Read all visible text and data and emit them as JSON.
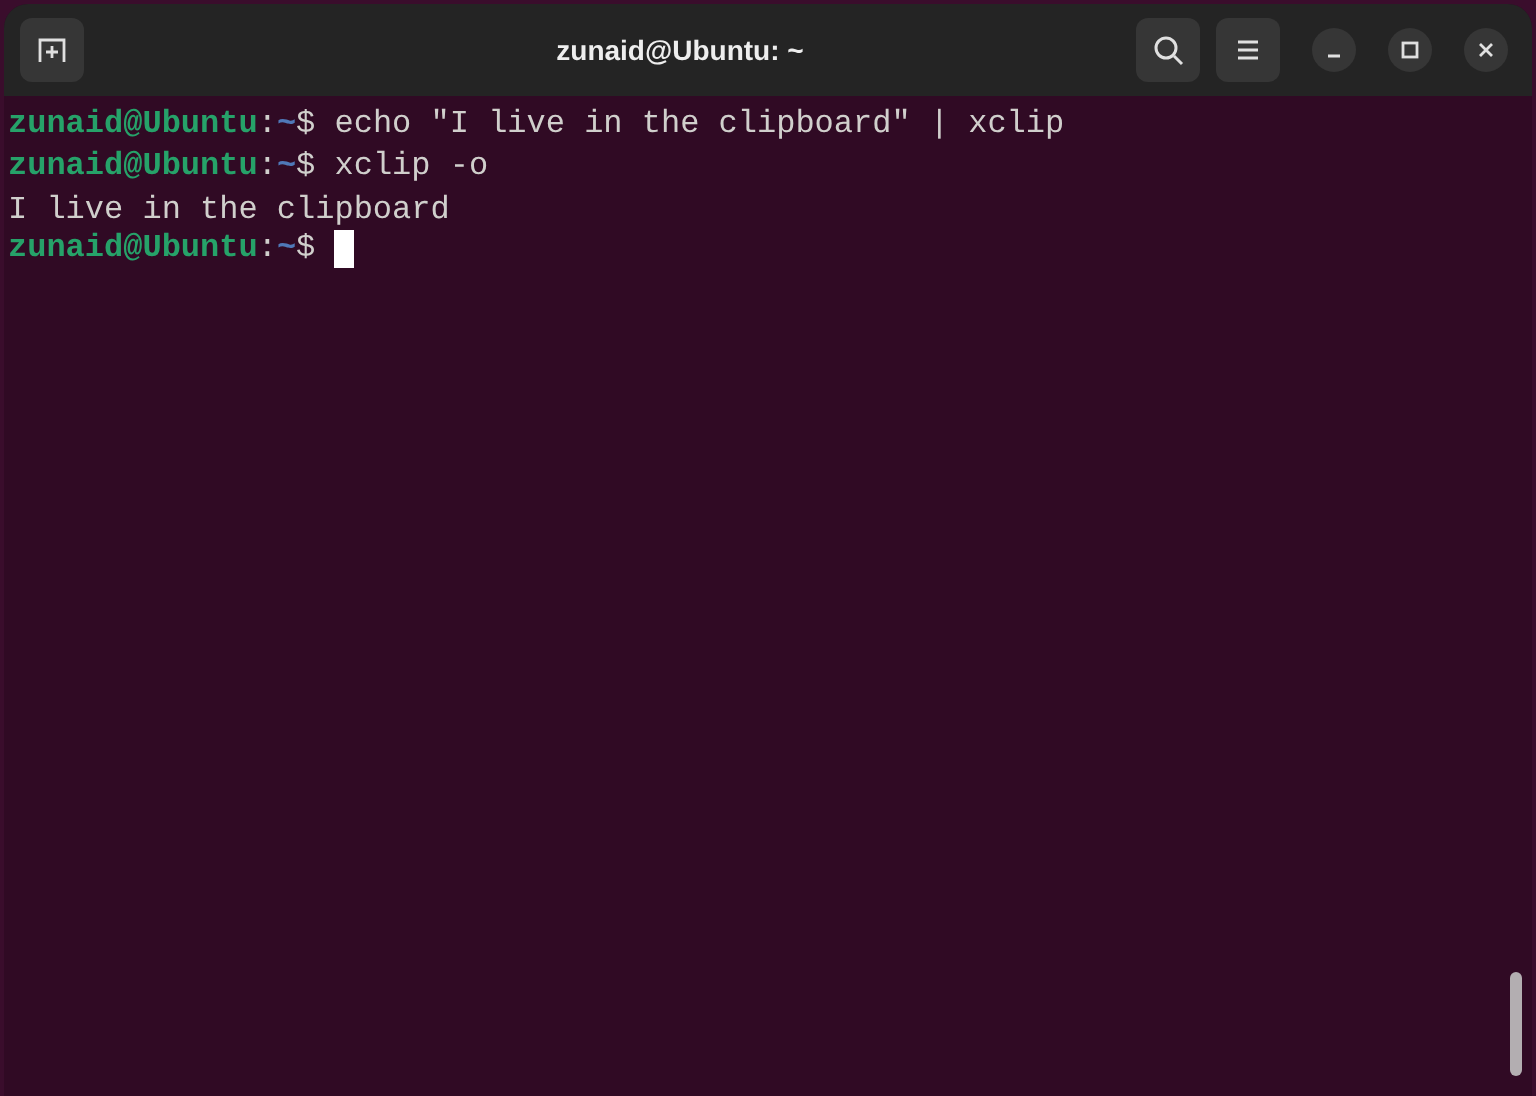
{
  "window": {
    "title": "zunaid@Ubuntu: ~"
  },
  "lines": [
    {
      "kind": "prompt",
      "host": "zunaid@Ubuntu",
      "separator": ":",
      "path": "~",
      "symbol": "$",
      "command": "echo \"I live in the clipboard\" | xclip",
      "cursor": false
    },
    {
      "kind": "prompt",
      "host": "zunaid@Ubuntu",
      "separator": ":",
      "path": "~",
      "symbol": "$",
      "command": "xclip -o",
      "cursor": false
    },
    {
      "kind": "output",
      "text": "I live in the clipboard"
    },
    {
      "kind": "prompt",
      "host": "zunaid@Ubuntu",
      "separator": ":",
      "path": "~",
      "symbol": "$",
      "cursor": true
    }
  ]
}
